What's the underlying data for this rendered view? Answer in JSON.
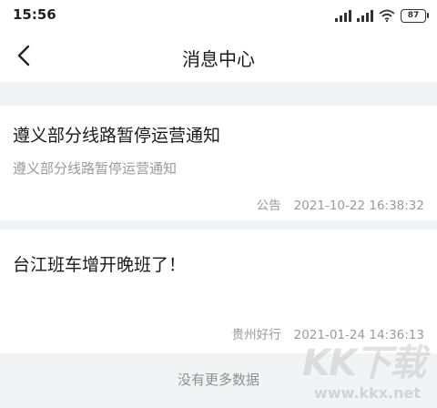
{
  "status_bar": {
    "time": "15:56",
    "battery": "87",
    "icons": [
      "signal-icon",
      "signal-icon",
      "wifi-icon",
      "battery-icon"
    ]
  },
  "header": {
    "title": "消息中心",
    "back_icon": "chevron-left-icon"
  },
  "messages": [
    {
      "title": "遵义部分线路暂停运营通知",
      "description": "遵义部分线路暂停运营通知",
      "source": "公告",
      "time": "2021-10-22 16:38:32"
    },
    {
      "title": "台江班车增开晚班了！",
      "description": "",
      "source": "贵州好行",
      "time": "2021-01-24 14:36:13"
    }
  ],
  "footer": {
    "no_more": "没有更多数据"
  },
  "watermark": {
    "logo": "KK下载",
    "url": "www.kkx.net"
  },
  "colors": {
    "background": "#f2f3f5",
    "card": "#ffffff",
    "primary_text": "#1a1a1a",
    "secondary_text": "#9a9a9a"
  }
}
